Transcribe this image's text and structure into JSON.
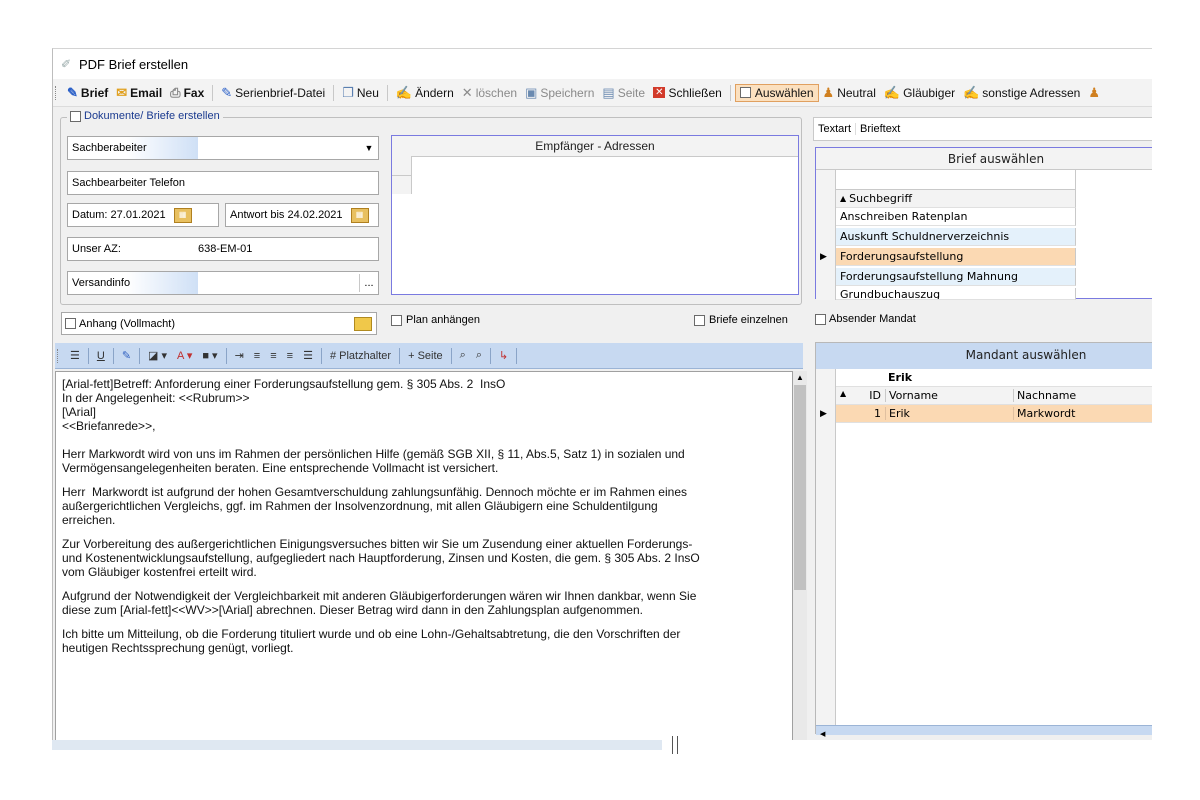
{
  "window": {
    "title": "PDF Brief erstellen"
  },
  "toolbar": {
    "brief": "Brief",
    "email": "Email",
    "fax": "Fax",
    "serienbrief": "Serienbrief-Datei",
    "neu": "Neu",
    "aendern": "Ändern",
    "loeschen": "löschen",
    "speichern": "Speichern",
    "seite": "Seite",
    "schliessen": "Schließen",
    "auswaehlen": "Auswählen",
    "neutral": "Neutral",
    "glaeubiger": "Gläubiger",
    "sonstige": "sonstige Adressen"
  },
  "form": {
    "group_label": "Dokumente/ Briefe erstellen",
    "sachbearbeiter_label": "Sachberabeiter",
    "sachbearbeiter_value": "",
    "telefon_label": "Sachbearbeiter Telefon",
    "datum_label": "Datum:",
    "datum_value": "27.01.2021",
    "antwort_label": "Antwort bis",
    "antwort_value": "24.02.2021",
    "az_label": "Unser AZ:",
    "az_value": "638-EM-01",
    "versandinfo_label": "Versandinfo",
    "versandinfo_btn": "...",
    "empfaenger_header": "Empfänger - Adressen",
    "anhang_label": "Anhang (Vollmacht)",
    "plan_label": "Plan anhängen",
    "einzeln_label": "Briefe einzelnen"
  },
  "editor_toolbar": {
    "platzhalter": "# Platzhalter",
    "seite": "+ Seite"
  },
  "editor": {
    "lines_block1": [
      "[Arial-fett]Betreff: Anforderung einer Forderungsaufstellung gem. § 305 Abs. 2  InsO",
      "In der Angelegenheit: <<Rubrum>>",
      "[\\Arial]",
      "<<Briefanrede>>,"
    ],
    "p1": "Herr Markwordt wird von uns im Rahmen der persönlichen Hilfe (gemäß SGB XII, § 11, Abs.5, Satz 1) in sozialen und\nVermögensangelegenheiten beraten. Eine entsprechende Vollmacht ist versichert.",
    "p2": "Herr  Markwordt ist aufgrund der hohen Gesamtverschuldung zahlungsunfähig. Dennoch möchte er im Rahmen eines\naußergerichtlichen Vergleichs, ggf. im Rahmen der Insolvenzordnung, mit allen Gläubigern eine Schuldentilgung\nerreichen.",
    "p3": "Zur Vorbereitung des außergerichtlichen Einigungsversuches bitten wir Sie um Zusendung einer aktuellen Forderungs-\nund Kostenentwicklungsaufstellung, aufgegliedert nach Hauptforderung, Zinsen und Kosten, die gem. § 305 Abs. 2 InsO\nvom Gläubiger kostenfrei erteilt wird.",
    "p4": "Aufgrund der Notwendigkeit der Vergleichbarkeit mit anderen Gläubigerforderungen wären wir Ihnen dankbar, wenn Sie\ndiese zum [Arial-fett]<<WV>>[\\Arial] abrechnen. Dieser Betrag wird dann in den Zahlungsplan aufgenommen.",
    "p5": "Ich bitte um Mitteilung, ob die Forderung tituliert wurde und ob eine Lohn-/Gehaltsabtretung, die den Vorschriften der\nheutigen Rechtssprechung genügt, vorliegt."
  },
  "right": {
    "tabs": [
      "Textart",
      "Brieftext"
    ],
    "brief_header": "Brief auswählen",
    "brief_col": "Suchbegriff",
    "brief_rows": [
      "Anschreiben Ratenplan",
      "Auskunft Schuldnerverzeichnis",
      "Forderungsaufstellung",
      "Forderungsaufstellung Mahnung",
      "Grundbuchauszug"
    ],
    "absender_label": "Absender Mandat",
    "mandant_header": "Mandant auswählen",
    "mandant_filter": "Erik",
    "mandant_cols": [
      "ID",
      "Vorname",
      "Nachname"
    ],
    "mandant_row": {
      "id": "1",
      "vorname": "Erik",
      "nachname": "Markwordt"
    }
  },
  "colors": {
    "selected_row": "#fbd9b3",
    "alt_row": "#e4f1fb",
    "grid_border": "#7a7ae0",
    "toolbar_blue": "#c7d9f1"
  }
}
